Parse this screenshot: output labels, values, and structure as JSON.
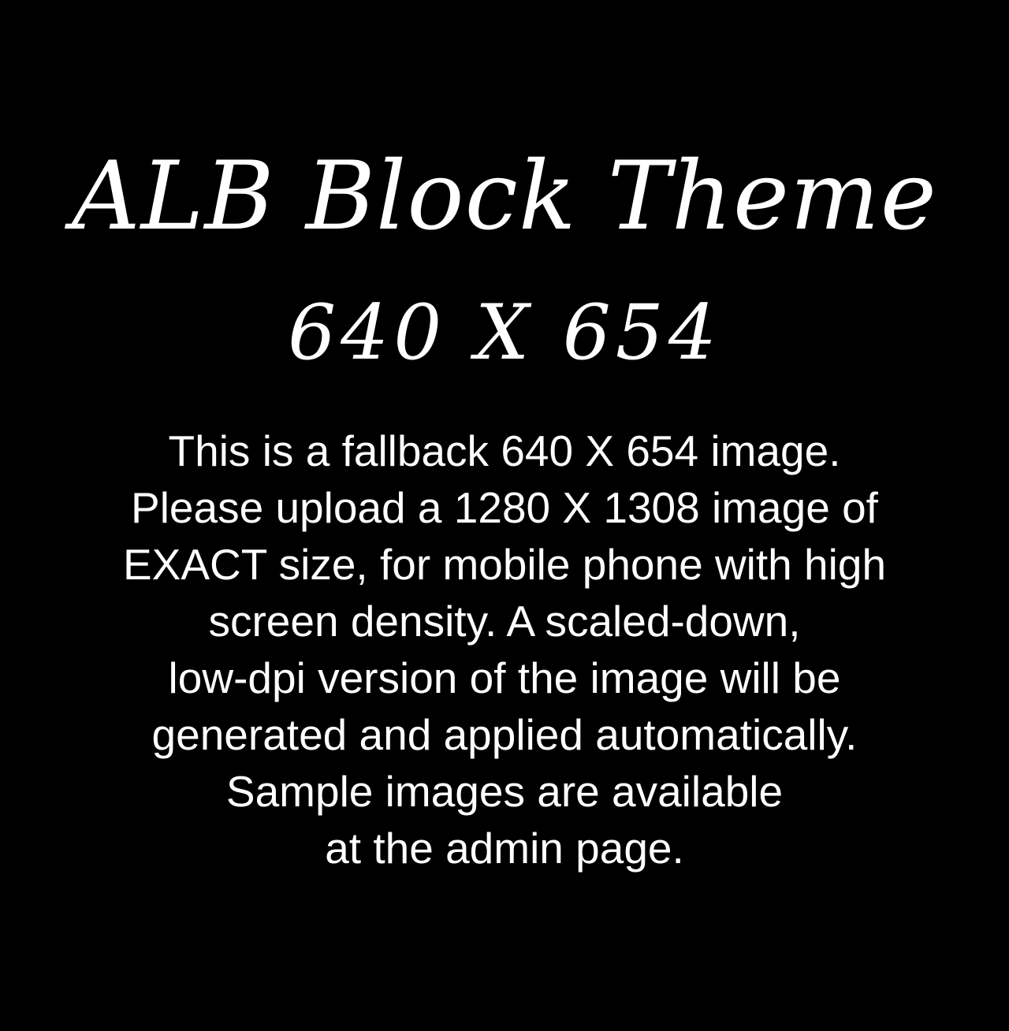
{
  "colors": {
    "background": "#000000",
    "text": "#ffffff"
  },
  "title": {
    "main": "ALB Block Theme",
    "dimensions": "640 X 654"
  },
  "message": {
    "lines": [
      "This is a fallback 640 X 654 image.",
      "Please upload a 1280 X 1308 image of",
      "EXACT size, for mobile phone with high",
      "screen density. A scaled-down,",
      "low-dpi version of the image will be",
      "generated and applied automatically.",
      "Sample images are available",
      "at the admin page."
    ]
  }
}
